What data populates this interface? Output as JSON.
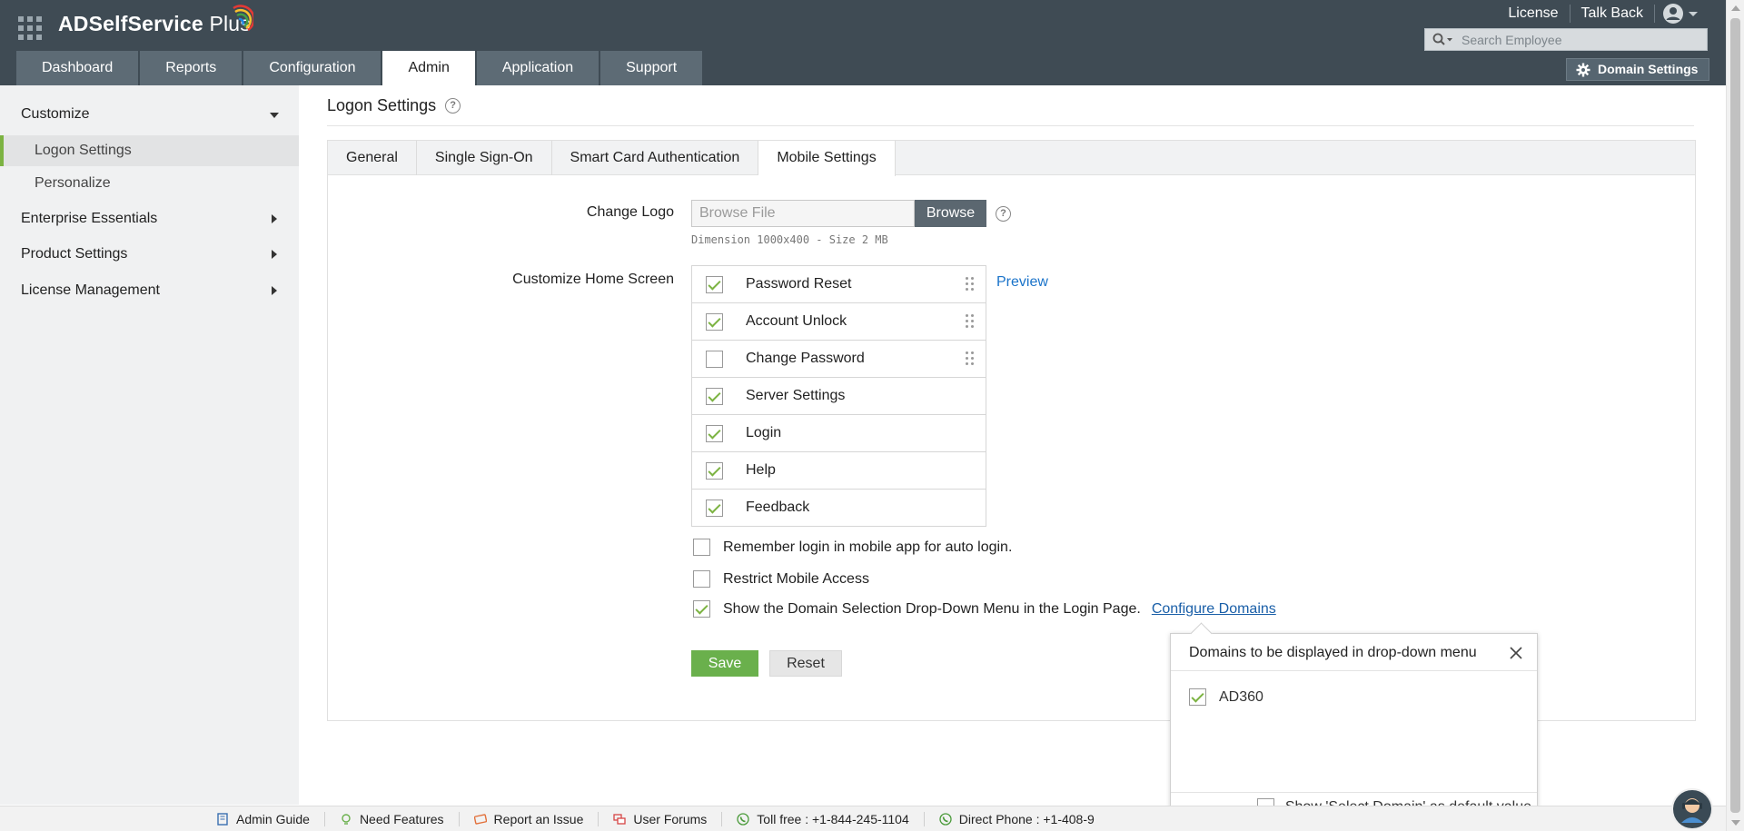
{
  "header": {
    "logo_text": "ADSelfService",
    "logo_plus": " Plus",
    "top_links": [
      "License",
      "Talk Back"
    ],
    "search_placeholder": "Search Employee",
    "domain_settings_label": "Domain Settings",
    "tabs": [
      "Dashboard",
      "Reports",
      "Configuration",
      "Admin",
      "Application",
      "Support"
    ],
    "active_tab": "Admin"
  },
  "sidebar": {
    "sections": [
      {
        "label": "Customize",
        "expanded": true
      },
      {
        "label": "Logon Settings",
        "active": true
      },
      {
        "label": "Personalize"
      },
      {
        "label": "Enterprise Essentials",
        "expanded": false
      },
      {
        "label": "Product Settings",
        "expanded": false
      },
      {
        "label": "License Management",
        "expanded": false
      }
    ]
  },
  "page": {
    "title": "Logon Settings",
    "tabs": [
      "General",
      "Single Sign-On",
      "Smart Card Authentication",
      "Mobile Settings"
    ],
    "active_tab": "Mobile Settings"
  },
  "form": {
    "change_logo_label": "Change Logo",
    "browse_placeholder": "Browse File",
    "browse_button": "Browse",
    "dimension_note": "Dimension 1000x400 - Size 2 MB",
    "customize_label": "Customize Home Screen",
    "preview_link": "Preview",
    "home_items": [
      {
        "label": "Password Reset",
        "checked": true,
        "draggable": true
      },
      {
        "label": "Account Unlock",
        "checked": true,
        "draggable": true
      },
      {
        "label": "Change Password",
        "checked": false,
        "draggable": true
      },
      {
        "label": "Server Settings",
        "checked": true,
        "draggable": false
      },
      {
        "label": "Login",
        "checked": true,
        "draggable": false
      },
      {
        "label": "Help",
        "checked": true,
        "draggable": false
      },
      {
        "label": "Feedback",
        "checked": true,
        "draggable": false
      }
    ],
    "options": [
      {
        "label": "Remember login in mobile app for auto login.",
        "checked": false
      },
      {
        "label": "Restrict Mobile Access",
        "checked": false
      },
      {
        "label": "Show the Domain Selection Drop-Down Menu in the Login Page.",
        "checked": true
      }
    ],
    "configure_domains_link": "Configure Domains",
    "save_button": "Save",
    "reset_button": "Reset"
  },
  "popover": {
    "title": "Domains to be displayed in drop-down menu",
    "domains": [
      {
        "label": "AD360",
        "checked": true
      }
    ],
    "default_option": {
      "label": "Show 'Select Domain' as default value",
      "checked": false
    }
  },
  "footer": {
    "items": [
      "Admin Guide",
      "Need Features",
      "Report an Issue",
      "User Forums",
      "Toll free : +1-844-245-1104",
      "Direct Phone : +1-408-9"
    ]
  },
  "colors": {
    "header_bg": "#3f4b54",
    "accent_green": "#7cb342",
    "save_green": "#6ab04c",
    "link_blue": "#1a73c9"
  }
}
